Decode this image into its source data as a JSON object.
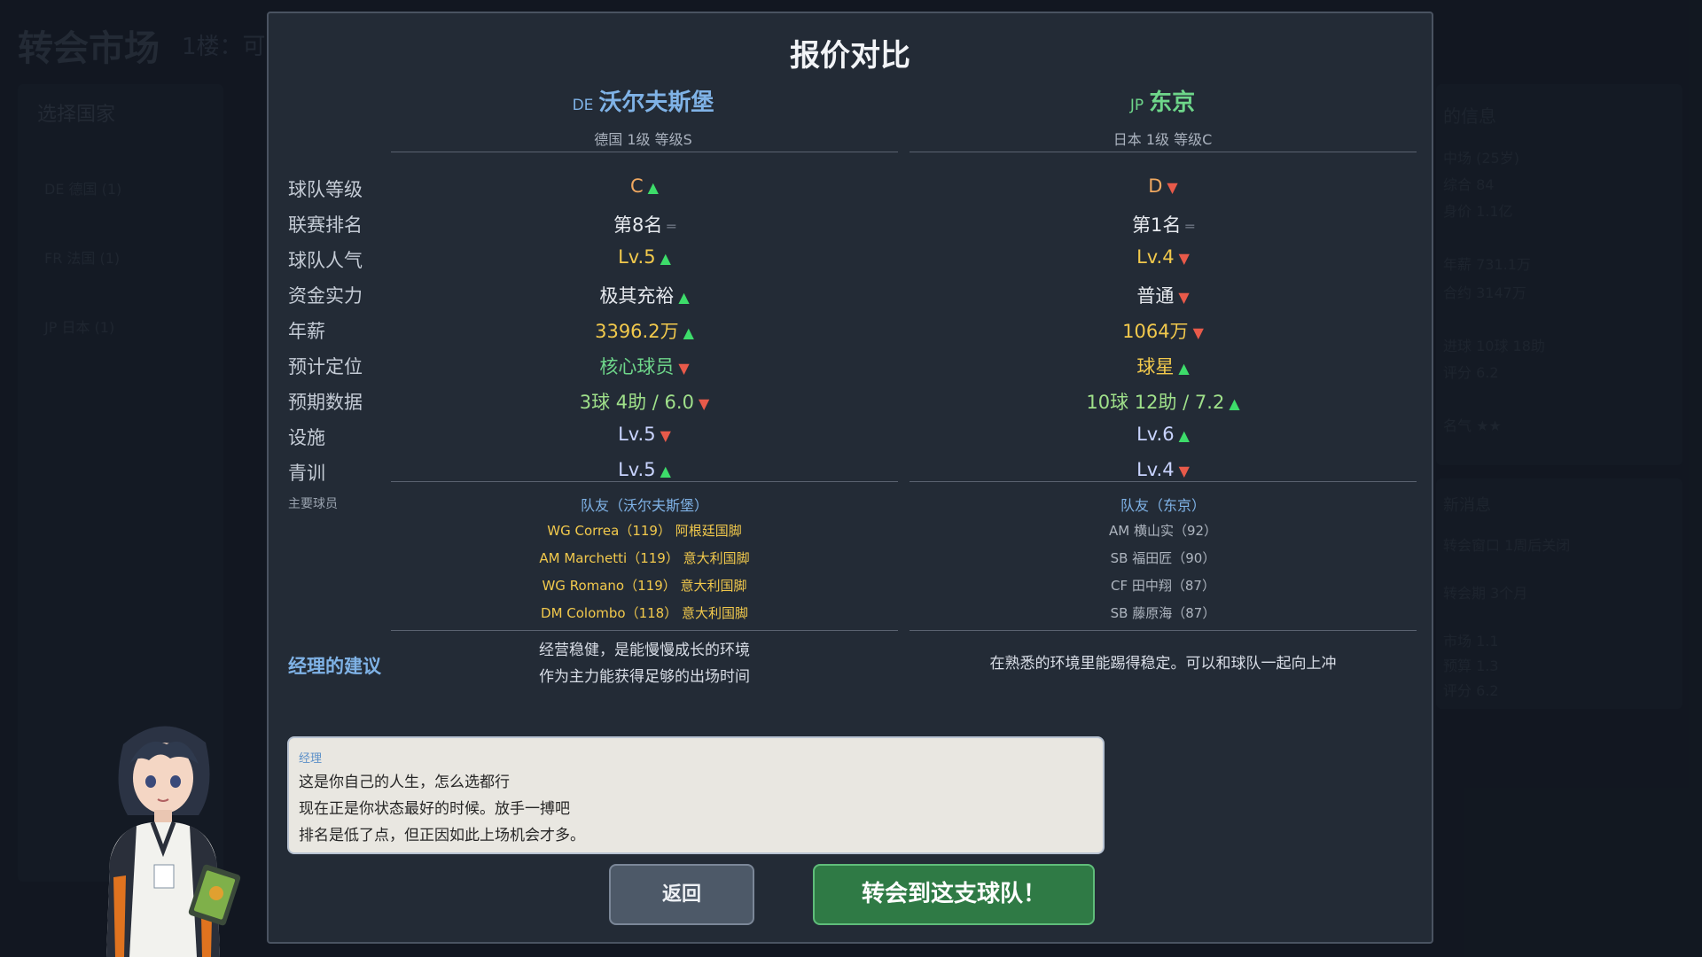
{
  "background": {
    "title": "转会市场",
    "subtitle": "1楼：可",
    "left_panel": {
      "title": "选择国家",
      "items": [
        "DE 德国 (1)",
        "FR 法国 (1)",
        "JP 日本 (1)"
      ]
    },
    "right_panel": {
      "title": "的信息",
      "lines": [
        "中场 (25岁)",
        "综合 84",
        "身价 1.1亿",
        "年薪 731.1万",
        "合约 3147万",
        "进球 10球 18助",
        "评分 6.2",
        "名气 ★★"
      ]
    },
    "right_panel2": {
      "title": "新消息",
      "lines": [
        "转会窗口 1周后关闭",
        "转会期 3个月",
        "市场 1.1",
        "预算 1.3",
        "评分 6.2"
      ]
    }
  },
  "modal": {
    "title": "报价对比",
    "team_a": {
      "code": "DE",
      "name": "沃尔夫斯堡",
      "league": "德国 1级  等级S",
      "color": "#7fb2e6"
    },
    "team_b": {
      "code": "JP",
      "name": "东京",
      "league": "日本 1级  等级C",
      "color": "#6ed68a"
    },
    "rows": [
      {
        "label": "球队等级",
        "a": "C",
        "a_arrow": "▲",
        "a_color": "#f0a860",
        "b": "D",
        "b_arrow": "▼",
        "b_color": "#f0a860"
      },
      {
        "label": "联赛排名",
        "a": "第8名",
        "a_arrow": "═",
        "a_color": "#e6e9ee",
        "b": "第1名",
        "b_arrow": "═",
        "b_color": "#e6e9ee"
      },
      {
        "label": "球队人气",
        "a": "Lv.5",
        "a_arrow": "▲",
        "a_color": "#f2c94c",
        "b": "Lv.4",
        "b_arrow": "▼",
        "b_color": "#f2c94c"
      },
      {
        "label": "资金实力",
        "a": "极其充裕",
        "a_arrow": "▲",
        "a_color": "#e6e9ee",
        "b": "普通",
        "b_arrow": "▼",
        "b_color": "#e6e9ee"
      },
      {
        "label": "年薪",
        "a": "3396.2万",
        "a_arrow": "▲",
        "a_color": "#f2c94c",
        "b": "1064万",
        "b_arrow": "▼",
        "b_color": "#f2c94c"
      },
      {
        "label": "预计定位",
        "a": "核心球员",
        "a_arrow": "▼",
        "a_color": "#6ed68a",
        "b": "球星",
        "b_arrow": "▲",
        "b_color": "#f2c94c"
      },
      {
        "label": "预期数据",
        "a": "3球 4助 / 6.0",
        "a_arrow": "▼",
        "a_color": "#9fe08a",
        "b": "10球 12助 / 7.2",
        "b_arrow": "▲",
        "b_color": "#9fe08a"
      },
      {
        "label": "设施",
        "a": "Lv.5",
        "a_arrow": "▼",
        "a_color": "#c9d4ff",
        "b": "Lv.6",
        "b_arrow": "▲",
        "b_color": "#c9d4ff"
      },
      {
        "label": "青训",
        "a": "Lv.5",
        "a_arrow": "▲",
        "a_color": "#c9d4ff",
        "b": "Lv.4",
        "b_arrow": "▼",
        "b_color": "#c9d4ff"
      }
    ],
    "players_label": "主要球员",
    "team_a_mates_title": "队友（沃尔夫斯堡）",
    "team_b_mates_title": "队友（东京）",
    "team_a_mates": [
      "WG Correa（119） 阿根廷国脚",
      "AM Marchetti（119） 意大利国脚",
      "WG Romano（119） 意大利国脚",
      "DM Colombo（118） 意大利国脚"
    ],
    "team_b_mates": [
      "AM 横山实（92）",
      "SB 福田匠（90）",
      "CF 田中翔（87）",
      "SB 藤原海（87）"
    ],
    "advice_label": "经理的建议",
    "advice_a": [
      "经营稳健，是能慢慢成长的环境",
      "作为主力能获得足够的出场时间"
    ],
    "advice_b": [
      "在熟悉的环境里能踢得稳定。可以和球队一起向上冲"
    ],
    "dialog": {
      "speaker": "经理",
      "lines": [
        "这是你自己的人生，怎么选都行",
        "现在正是你状态最好的时候。放手一搏吧",
        "排名是低了点，但正因如此上场机会才多。"
      ]
    },
    "back_button": "返回",
    "transfer_button": "转会到这支球队！"
  }
}
